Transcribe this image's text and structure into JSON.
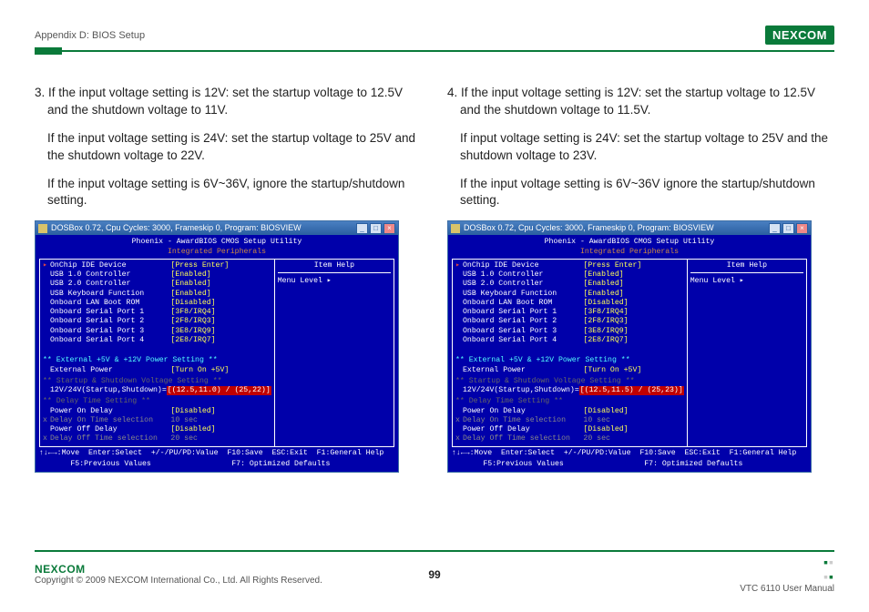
{
  "header": {
    "section": "Appendix D: BIOS Setup",
    "logo_text": "NEXCOM"
  },
  "left": {
    "p1": "3. If the input voltage setting is 12V: set the startup voltage to 12.5V and the shutdown voltage to 11V.",
    "p2": "If the input voltage setting is 24V: set the startup voltage to 25V and the shutdown voltage to 22V.",
    "p3": "If the input voltage setting is 6V~36V, ignore the startup/shutdown setting.",
    "bios": {
      "window_title": "DOSBox 0.72, Cpu Cycles:   3000, Frameskip  0, Program: BIOSVIEW",
      "title1": "Phoenix - AwardBIOS CMOS Setup Utility",
      "title2": "Integrated Peripherals",
      "help_title": "Item Help",
      "menu_level": "Menu Level   ▸",
      "rows": [
        {
          "label": "OnChip IDE Device",
          "val": "[Press Enter]",
          "arrow": true
        },
        {
          "label": "USB 1.0 Controller",
          "val": "[Enabled]",
          "arrow": false
        },
        {
          "label": "USB 2.0 Controller",
          "val": "[Enabled]",
          "arrow": false
        },
        {
          "label": "USB Keyboard Function",
          "val": "[Enabled]",
          "arrow": false
        },
        {
          "label": "Onboard LAN Boot ROM",
          "val": "[Disabled]",
          "arrow": false
        },
        {
          "label": "Onboard Serial Port 1",
          "val": "[3F8/IRQ4]",
          "arrow": false
        },
        {
          "label": "Onboard Serial Port 2",
          "val": "[2F8/IRQ3]",
          "arrow": false
        },
        {
          "label": "Onboard Serial Port 3",
          "val": "[3E8/IRQ9]",
          "arrow": false
        },
        {
          "label": "Onboard Serial Port 4",
          "val": "[2E8/IRQ7]",
          "arrow": false
        }
      ],
      "section1": "** External +5V & +12V Power Setting **",
      "ext_power_label": "External Power",
      "ext_power_val": "[Turn On +5V]",
      "section2": "** Startup & Shutdown Voltage Setting **",
      "volt_label": "12V/24V(Startup,Shutdown)=",
      "volt_val": "[(12.5,11.0) / (25,22)]",
      "section3": "** Delay Time Setting **",
      "pon_label": "Power On Delay",
      "pon_val": "[Disabled]",
      "don_label": "Delay On Time selection",
      "don_val": "10 sec",
      "poff_label": "Power Off Delay",
      "poff_val": "[Disabled]",
      "doff_label": "Delay Off Time selection",
      "doff_val": "20 sec",
      "footer1": "↑↓←→:Move  Enter:Select  +/-/PU/PD:Value  F10:Save  ESC:Exit  F1:General Help",
      "footer2": "       F5:Previous Values                  F7: Optimized Defaults"
    }
  },
  "right": {
    "p1": "4. If the input voltage setting is 12V: set the startup voltage to 12.5V and the shutdown voltage to 11.5V.",
    "p2": "If input voltage setting is 24V: set the startup voltage to 25V and the shutdown voltage to 23V.",
    "p3": "If the input voltage setting is 6V~36V ignore the startup/shutdown setting.",
    "bios": {
      "window_title": "DOSBox 0.72, Cpu Cycles:   3000, Frameskip  0, Program: BIOSVIEW",
      "title1": "Phoenix - AwardBIOS CMOS Setup Utility",
      "title2": "Integrated Peripherals",
      "help_title": "Item Help",
      "menu_level": "Menu Level   ▸",
      "rows": [
        {
          "label": "OnChip IDE Device",
          "val": "[Press Enter]",
          "arrow": true
        },
        {
          "label": "USB 1.0 Controller",
          "val": "[Enabled]",
          "arrow": false
        },
        {
          "label": "USB 2.0 Controller",
          "val": "[Enabled]",
          "arrow": false
        },
        {
          "label": "USB Keyboard Function",
          "val": "[Enabled]",
          "arrow": false
        },
        {
          "label": "Onboard LAN Boot ROM",
          "val": "[Disabled]",
          "arrow": false
        },
        {
          "label": "Onboard Serial Port 1",
          "val": "[3F8/IRQ4]",
          "arrow": false
        },
        {
          "label": "Onboard Serial Port 2",
          "val": "[2F8/IRQ3]",
          "arrow": false
        },
        {
          "label": "Onboard Serial Port 3",
          "val": "[3E8/IRQ9]",
          "arrow": false
        },
        {
          "label": "Onboard Serial Port 4",
          "val": "[2E8/IRQ7]",
          "arrow": false
        }
      ],
      "section1": "** External +5V & +12V Power Setting **",
      "ext_power_label": "External Power",
      "ext_power_val": "[Turn On +5V]",
      "section2": "** Startup & Shutdown Voltage Setting **",
      "volt_label": "12V/24V(Startup,Shutdown)=",
      "volt_val": "[(12.5,11.5) / (25,23)]",
      "section3": "** Delay Time Setting **",
      "pon_label": "Power On Delay",
      "pon_val": "[Disabled]",
      "don_label": "Delay On Time selection",
      "don_val": "10 sec",
      "poff_label": "Power Off Delay",
      "poff_val": "[Disabled]",
      "doff_label": "Delay Off Time selection",
      "doff_val": "20 sec",
      "footer1": "↑↓←→:Move  Enter:Select  +/-/PU/PD:Value  F10:Save  ESC:Exit  F1:General Help",
      "footer2": "       F5:Previous Values                  F7: Optimized Defaults"
    }
  },
  "footer": {
    "logo": "NEXCOM",
    "copyright": "Copyright © 2009 NEXCOM International Co., Ltd. All Rights Reserved.",
    "page": "99",
    "manual": "VTC 6110 User Manual"
  }
}
